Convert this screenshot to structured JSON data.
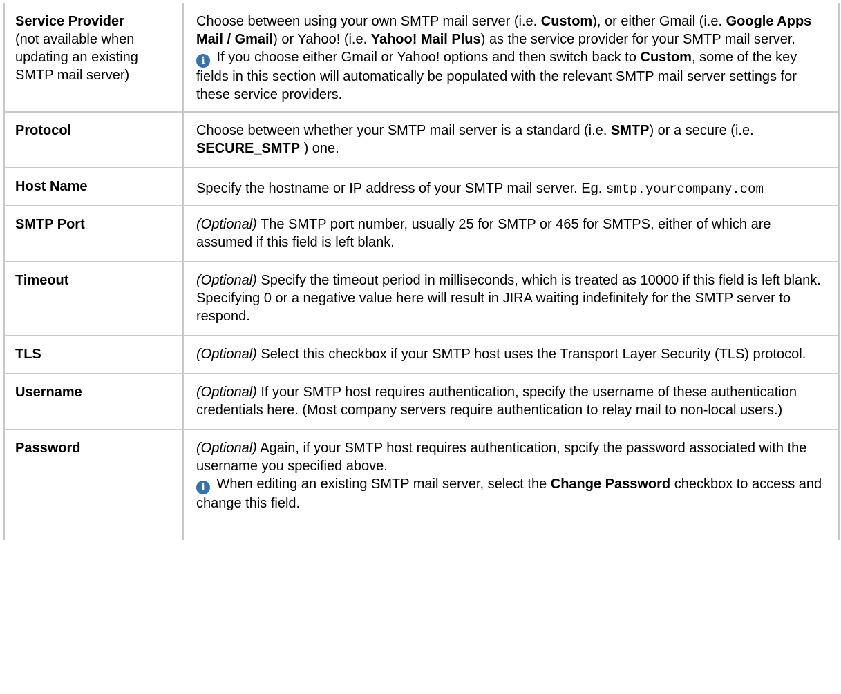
{
  "rows": [
    {
      "name": "Service Provider",
      "note": "(not available when updating an existing SMTP mail server)",
      "desc": {
        "t1": "Choose between using your own SMTP mail server (i.e. ",
        "b1": "Custom",
        "t2": "), or either Gmail (i.e. ",
        "b2": "Google Apps Mail / Gmail",
        "t3": ") or Yahoo! (i.e. ",
        "b3": "Yahoo! Mail Plus",
        "t4": ") as the service provider for your SMTP mail server.",
        "info_t1": " If you choose either Gmail or Yahoo! options and then switch back to ",
        "info_b1": "Custom",
        "info_t2": ", some of the key fields in this section will automatically be populated with the relevant SMTP mail server settings for these service providers."
      }
    },
    {
      "name": "Protocol",
      "desc": {
        "t1": "Choose between whether your SMTP mail server is a standard (i.e. ",
        "b1": "SMTP",
        "t2": ") or a secure (i.e. ",
        "b2": "SECURE_SMTP",
        "t3": " ) one."
      }
    },
    {
      "name": "Host Name",
      "desc": {
        "t1": "Specify the hostname or IP address of your SMTP mail server. Eg. ",
        "code": "smtp.yourcompany.com"
      }
    },
    {
      "name": "SMTP Port",
      "desc": {
        "opt": "(Optional)",
        "t1": " The SMTP port number, usually 25 for SMTP or 465 for SMTPS, either of which are assumed if this field is left blank."
      }
    },
    {
      "name": "Timeout",
      "desc": {
        "opt": "(Optional)",
        "t1": " Specify the timeout period in milliseconds, which is treated as 10000 if this field is left blank. Specifying 0 or a negative value here will result in JIRA waiting indefinitely for the SMTP server to respond."
      }
    },
    {
      "name": "TLS",
      "desc": {
        "opt": "(Optional)",
        "t1": " Select this checkbox if your SMTP host uses the Transport Layer Security (TLS) protocol."
      }
    },
    {
      "name": "Username",
      "desc": {
        "opt": "(Optional)",
        "t1": " If your SMTP host requires authentication, specify the username of these authentication credentials here. (Most company servers require authentication to relay mail to non-local users.)"
      }
    },
    {
      "name": "Password",
      "desc": {
        "opt": "(Optional)",
        "t1": " Again, if your SMTP host requires authentication, spcify the password associated with the username you specified above.",
        "info_t1": " When editing an existing SMTP mail server, select the ",
        "info_b1": "Change Password",
        "info_t2": " checkbox to access and change this field."
      }
    }
  ],
  "icons": {
    "info_icon": "info-icon",
    "info_glyph": "i",
    "info_color": "#3572b0"
  }
}
